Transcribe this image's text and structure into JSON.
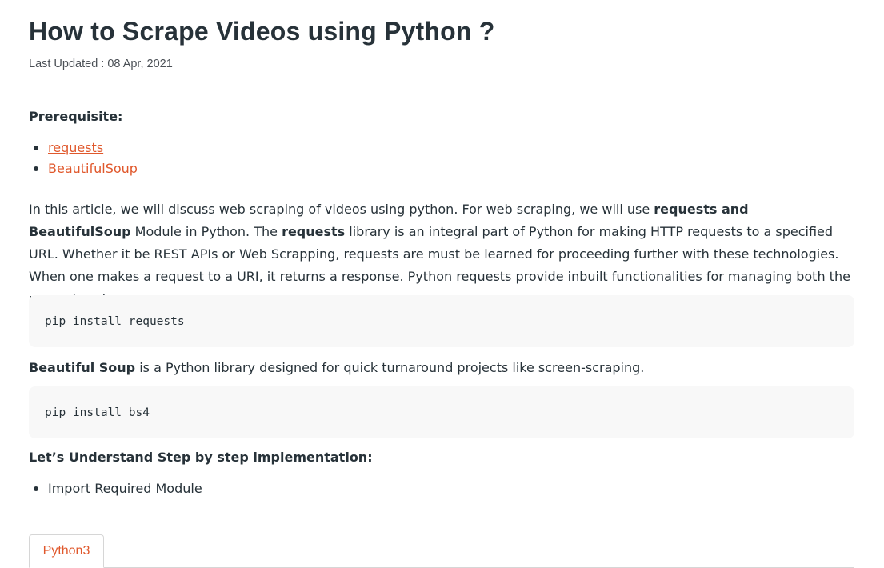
{
  "article": {
    "title": "How to Scrape Videos using Python ?",
    "last_updated": "Last Updated : 08 Apr, 2021",
    "prerequisite_label": "Prerequisite:",
    "prerequisites": [
      "requests",
      "BeautifulSoup"
    ],
    "intro": {
      "part1": "In this article, we will discuss web scraping of videos using python. For web scraping, we will use ",
      "bold1": "requests and BeautifulSoup",
      "part2": " Module in Python. The ",
      "bold2": "requests",
      "part3": " library is an integral part of Python for making HTTP requests to a specified URL. Whether it be REST APIs or Web Scrapping, requests are must be learned for proceeding further with these technologies. When one makes a request to a URI, it returns a response. Python requests provide inbuilt functionalities for managing both the request and response."
    },
    "code1": "pip install requests",
    "bs": {
      "bold": "Beautiful Soup",
      "rest": " is a Python library designed for quick turnaround projects like screen-scraping."
    },
    "code2": "pip install bs4",
    "steps_heading": "Let’s Understand Step by step implementation:",
    "steps": [
      "Import Required Module"
    ],
    "tabs": [
      "Python3"
    ]
  },
  "colors": {
    "link": "#e0582c",
    "text": "#273239",
    "code_bg": "#f8f8f8"
  }
}
